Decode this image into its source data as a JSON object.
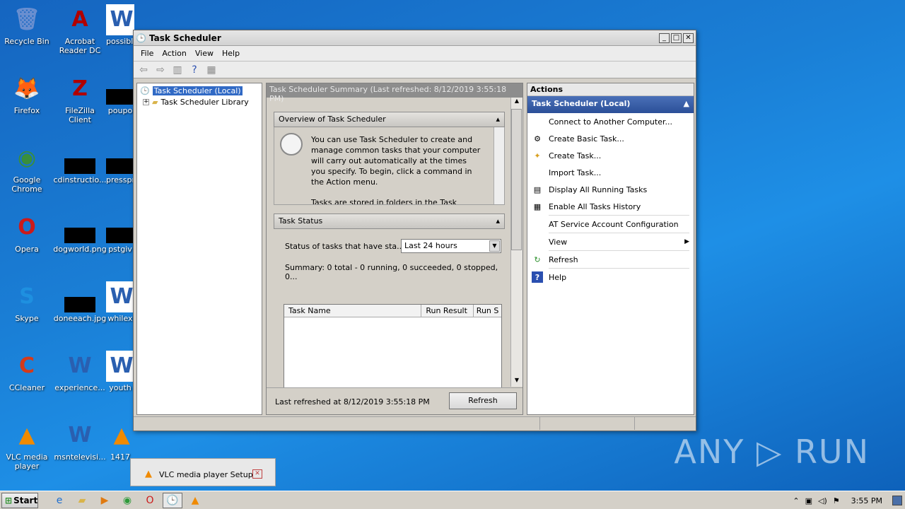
{
  "desktop": {
    "icons": [
      {
        "label": "Recycle Bin",
        "glyph": "🗑"
      },
      {
        "label": "Acrobat Reader DC",
        "glyph": "A"
      },
      {
        "label": "possible",
        "glyph": "W"
      },
      {
        "label": "Firefox",
        "glyph": "🦊"
      },
      {
        "label": "FileZilla Client",
        "glyph": "Z"
      },
      {
        "label": "poupo",
        "glyph": ""
      },
      {
        "label": "Google Chrome",
        "glyph": "◉"
      },
      {
        "label": "cdinstructio...",
        "glyph": ""
      },
      {
        "label": "presspr",
        "glyph": ""
      },
      {
        "label": "Opera",
        "glyph": "O"
      },
      {
        "label": "dogworld.png",
        "glyph": ""
      },
      {
        "label": "pstgiv",
        "glyph": ""
      },
      {
        "label": "Skype",
        "glyph": "S"
      },
      {
        "label": "doneeach.jpg",
        "glyph": ""
      },
      {
        "label": "whilex",
        "glyph": "W"
      },
      {
        "label": "CCleaner",
        "glyph": "C"
      },
      {
        "label": "experience...",
        "glyph": "W"
      },
      {
        "label": "youth",
        "glyph": "W"
      },
      {
        "label": "VLC media player",
        "glyph": "▲"
      },
      {
        "label": "msntelevisi...",
        "glyph": "W"
      },
      {
        "label": "1417",
        "glyph": "▲"
      }
    ]
  },
  "window": {
    "title": "Task Scheduler",
    "menu": [
      "File",
      "Action",
      "View",
      "Help"
    ]
  },
  "tree": {
    "root": "Task Scheduler (Local)",
    "child": "Task Scheduler Library"
  },
  "summary": {
    "header": "Task Scheduler Summary (Last refreshed: 8/12/2019 3:55:18 PM)",
    "overview_title": "Overview of Task Scheduler",
    "overview_text": "You can use Task Scheduler to create and manage common tasks that your computer will carry out automatically at the times you specify. To begin, click a command in the Action menu.",
    "overview_text2": "Tasks are stored in folders in the Task",
    "status_title": "Task Status",
    "status_label": "Status of tasks that have sta...",
    "status_select": "Last 24 hours",
    "status_summary": "Summary: 0 total - 0 running, 0 succeeded, 0 stopped, 0...",
    "columns": [
      "Task Name",
      "Run Result",
      "Run S"
    ],
    "last_refreshed": "Last refreshed at 8/12/2019 3:55:18 PM",
    "refresh_button": "Refresh"
  },
  "actions": {
    "title": "Actions",
    "group": "Task Scheduler (Local)",
    "items": [
      {
        "label": "Connect to Another Computer...",
        "icon": ""
      },
      {
        "label": "Create Basic Task...",
        "icon": "⚙"
      },
      {
        "label": "Create Task...",
        "icon": "✦"
      },
      {
        "label": "Import Task...",
        "icon": ""
      },
      {
        "label": "Display All Running Tasks",
        "icon": "▤"
      },
      {
        "label": "Enable All Tasks History",
        "icon": "▦"
      },
      {
        "label": "AT Service Account Configuration",
        "icon": ""
      },
      {
        "label": "View",
        "icon": ""
      },
      {
        "label": "Refresh",
        "icon": "↻"
      },
      {
        "label": "Help",
        "icon": "?"
      }
    ]
  },
  "popup": {
    "label": "VLC media player Setup"
  },
  "taskbar": {
    "start": "Start",
    "time": "3:55 PM"
  },
  "watermark": "ANY ▷ RUN"
}
